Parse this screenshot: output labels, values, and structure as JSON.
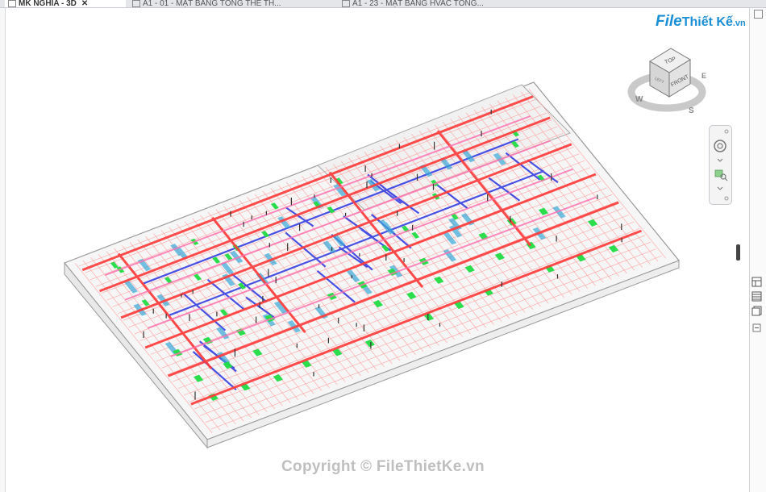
{
  "tabs": [
    {
      "label": "MK NGHIA - 3D",
      "close": "✕",
      "icon": "3d-view-icon",
      "active": true
    },
    {
      "label": "A1 - 01 - MẶT BẰNG TỔNG THỂ TH...",
      "icon": "sheet-icon",
      "active": false
    },
    {
      "label": "A1 - 23 - MẶT BẰNG HVAC TỔNG...",
      "icon": "sheet-icon",
      "active": false
    }
  ],
  "watermark": {
    "file": "File",
    "thiet_ke": "Thiết Kế",
    "vn": ".vn"
  },
  "copyright": "Copyright © FileThietKe.vn",
  "viewcube": {
    "top": "TOP",
    "front": "FRONT",
    "left": "LEFT",
    "compass": {
      "w": "W",
      "s": "S",
      "e": "E"
    }
  },
  "colors": {
    "duct_red": "#ff3a3a",
    "pipe_blue": "#2a35e0",
    "sprinkler_green": "#22dd44",
    "tray_cyan": "#3aa9d9",
    "structure_gray": "#9a9a9a",
    "pink": "#ff6fae"
  }
}
